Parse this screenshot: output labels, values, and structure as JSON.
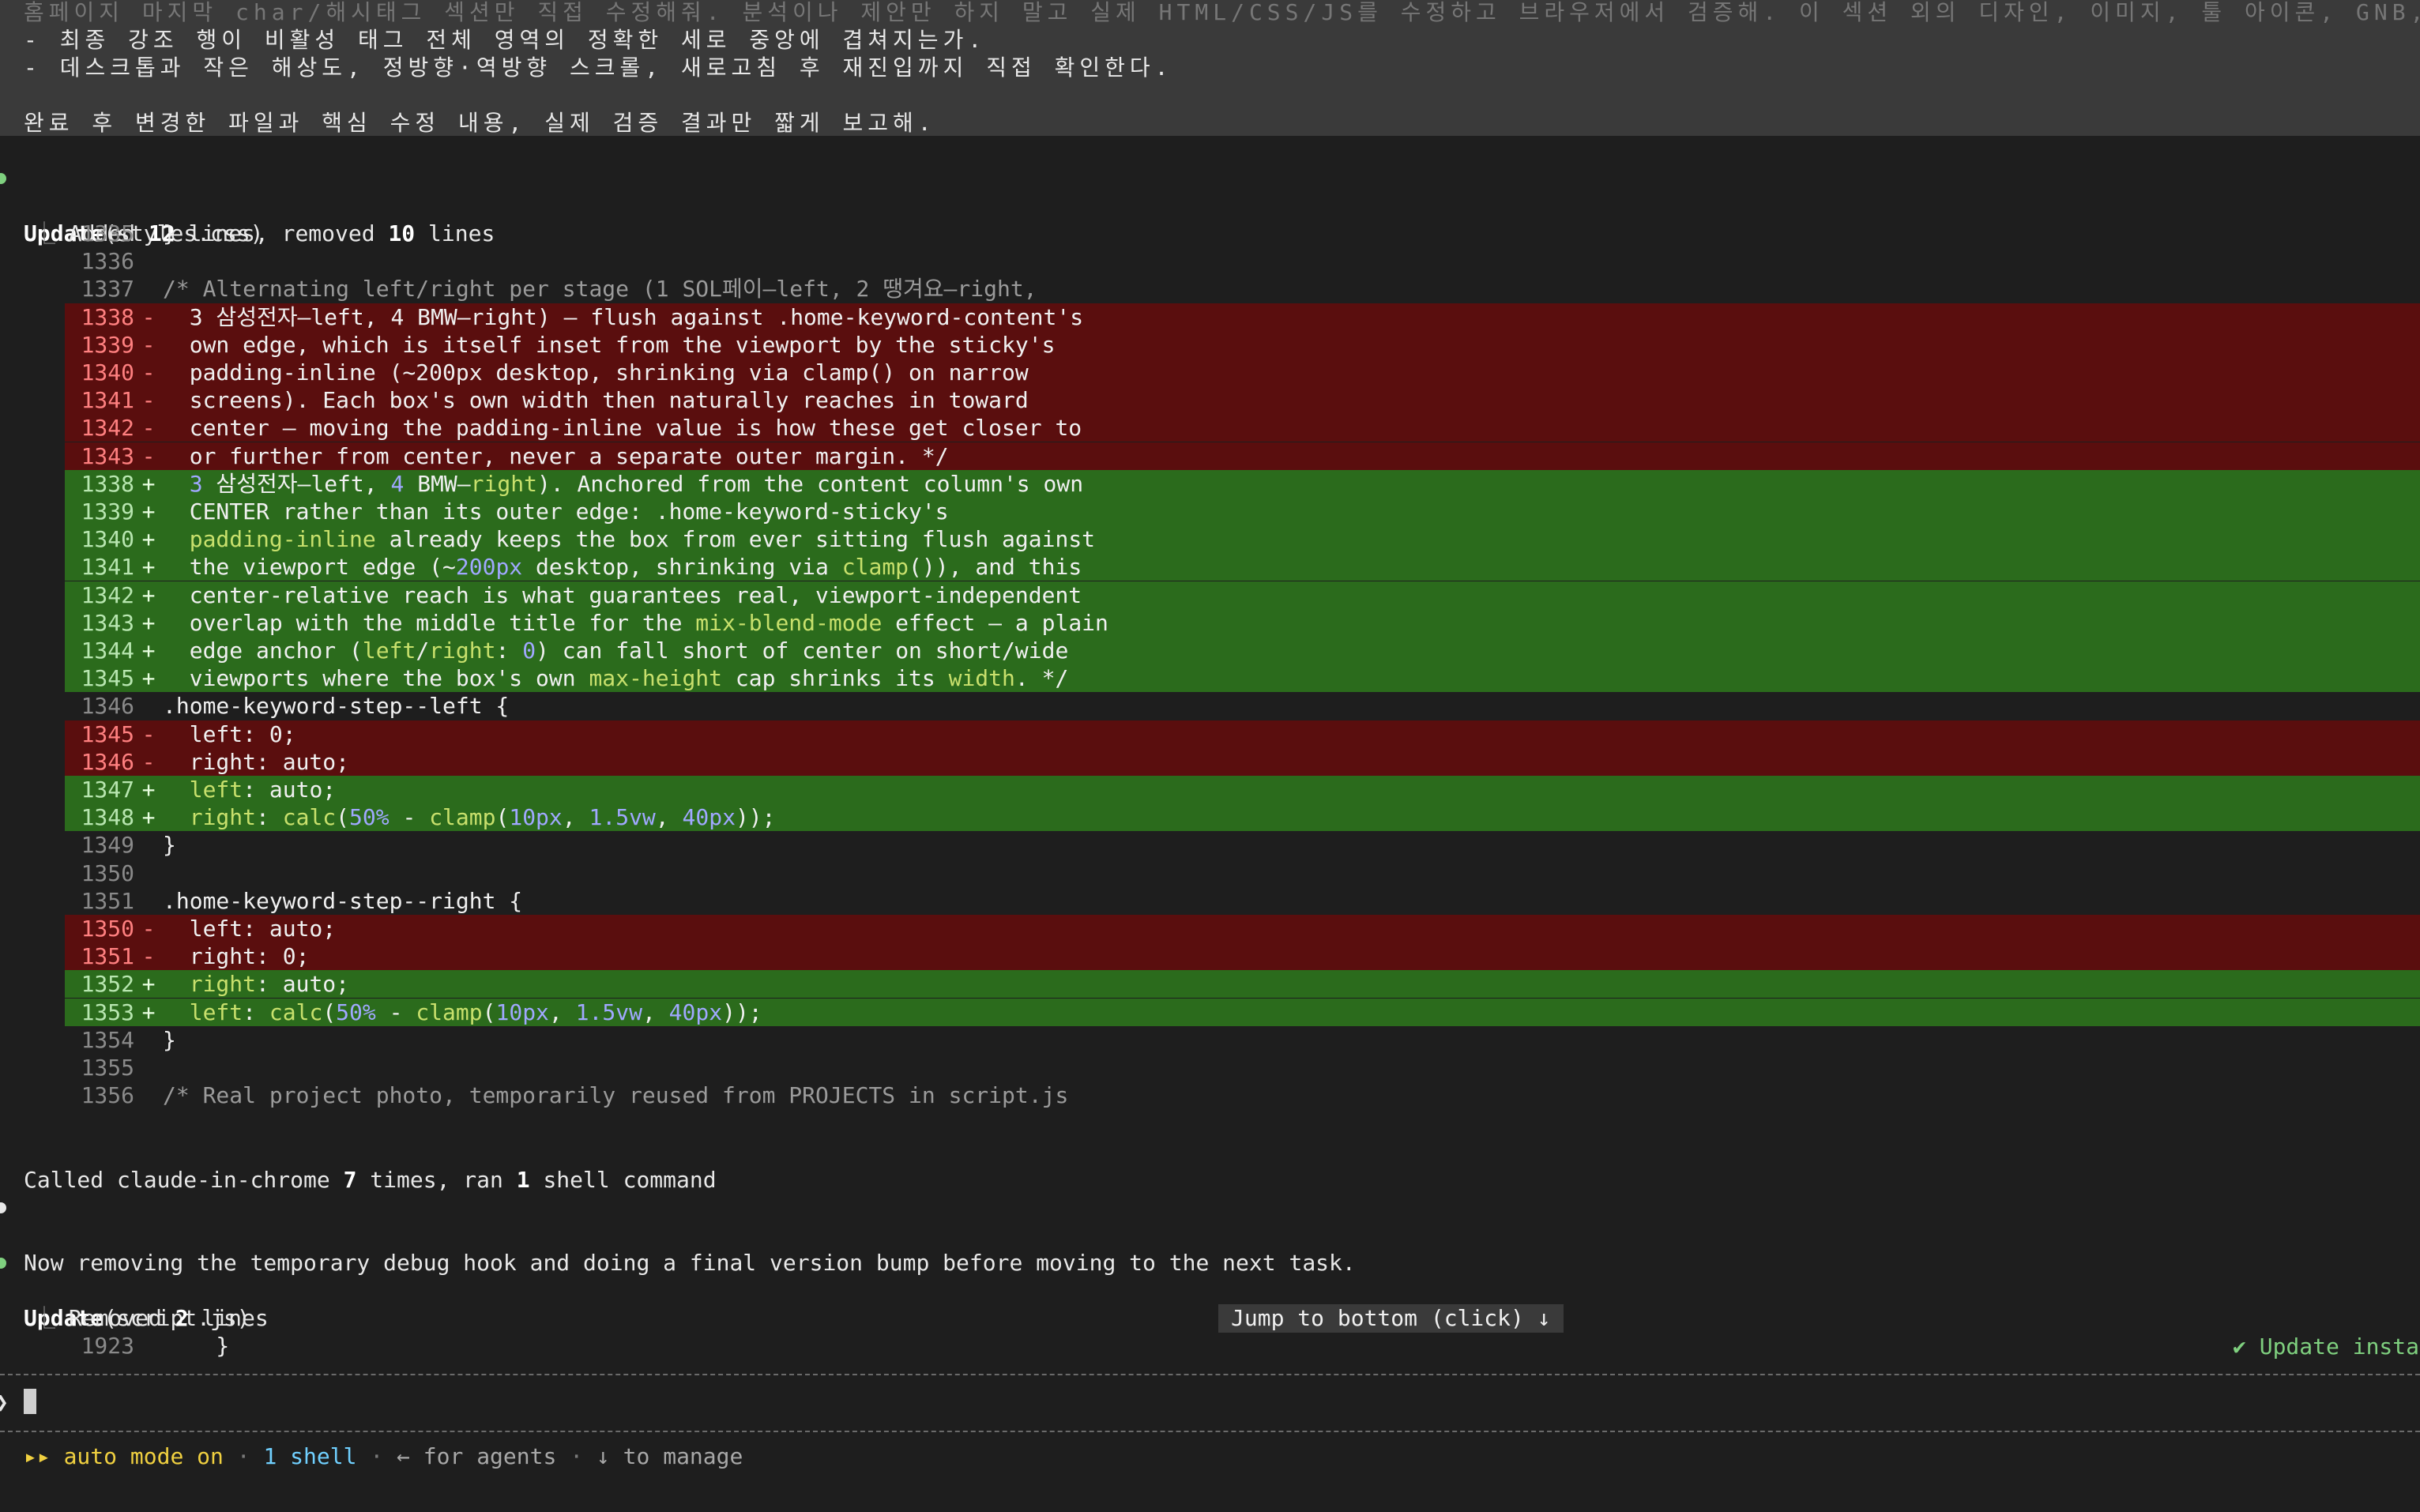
{
  "prompt": {
    "line0": "홈페이지 마지막 char/해시태그 섹션만 직접 수정해줘. 분석이나 제안만 하지 말고 실제 HTML/CSS/JS를 수정하고 브라우저에서 검증해. 이 섹션 외의 디자인, 이미지, 툴 아이콘, GNB,",
    "line1": "- 최종 강조 행이 비활성 태그 전체 영역의 정확한 세로 중앙에 겹쳐지는가.",
    "line2": "- 데스크톱과 작은 해상도, 정방향·역방향 스크롤, 새로고침 후 재진입까지 직접 확인한다.",
    "line3": "완료 후 변경한 파일과 핵심 수정 내용, 실제 검증 결과만 짧게 보고해."
  },
  "update1": {
    "verb": "Update",
    "file": "(styles.css)",
    "summary_pre": "Added ",
    "added": "12",
    "summary_mid": " lines, removed ",
    "removed": "10",
    "summary_post": " lines"
  },
  "diff": [
    {
      "n": "1335",
      "s": " ",
      "t": "ctx",
      "c": "}"
    },
    {
      "n": "1336",
      "s": " ",
      "t": "ctx",
      "c": ""
    },
    {
      "n": "1337",
      "s": " ",
      "t": "ctx",
      "c": "/* Alternating left/right per stage (1 SOL페이—left, 2 땡겨요—right,"
    },
    {
      "n": "1338",
      "s": "-",
      "t": "del",
      "c": "  3 삼성전자—left, 4 BMW—right) — flush against .home-keyword-content's"
    },
    {
      "n": "1339",
      "s": "-",
      "t": "del",
      "c": "  own edge, which is itself inset from the viewport by the sticky's"
    },
    {
      "n": "1340",
      "s": "-",
      "t": "del",
      "c": "  padding-inline (~200px desktop, shrinking via clamp() on narrow"
    },
    {
      "n": "1341",
      "s": "-",
      "t": "del",
      "c": "  screens). Each box's own width then naturally reaches in toward"
    },
    {
      "n": "1342",
      "s": "-",
      "t": "del",
      "c": "  center — moving the padding-inline value is how these get closer to"
    },
    {
      "n": "1343",
      "s": "-",
      "t": "del",
      "c": "  or further from center, never a separate outer margin. */"
    },
    {
      "n": "1338",
      "s": "+",
      "t": "add",
      "c": "  3 삼성전자—left, 4 BMW—right). Anchored from the content column's own"
    },
    {
      "n": "1339",
      "s": "+",
      "t": "add",
      "c": "  CENTER rather than its outer edge: .home-keyword-sticky's"
    },
    {
      "n": "1340",
      "s": "+",
      "t": "add",
      "c": "  padding-inline already keeps the box from ever sitting flush against"
    },
    {
      "n": "1341",
      "s": "+",
      "t": "add",
      "c": "  the viewport edge (~200px desktop, shrinking via clamp()), and this"
    },
    {
      "n": "1342",
      "s": "+",
      "t": "add",
      "c": "  center-relative reach is what guarantees real, viewport-independent"
    },
    {
      "n": "1343",
      "s": "+",
      "t": "add",
      "c": "  overlap with the middle title for the mix-blend-mode effect — a plain"
    },
    {
      "n": "1344",
      "s": "+",
      "t": "add",
      "c": "  edge anchor (left/right: 0) can fall short of center on short/wide"
    },
    {
      "n": "1345",
      "s": "+",
      "t": "add",
      "c": "  viewports where the box's own max-height cap shrinks its width. */"
    },
    {
      "n": "1346",
      "s": " ",
      "t": "ctx",
      "c": ".home-keyword-step--left {"
    },
    {
      "n": "1345",
      "s": "-",
      "t": "del",
      "c": "  left: 0;"
    },
    {
      "n": "1346",
      "s": "-",
      "t": "del",
      "c": "  right: auto;"
    },
    {
      "n": "1347",
      "s": "+",
      "t": "add",
      "c": "  left: auto;"
    },
    {
      "n": "1348",
      "s": "+",
      "t": "add",
      "c": "  right: calc(50% - clamp(10px, 1.5vw, 40px));"
    },
    {
      "n": "1349",
      "s": " ",
      "t": "ctx",
      "c": "}"
    },
    {
      "n": "1350",
      "s": " ",
      "t": "ctx",
      "c": ""
    },
    {
      "n": "1351",
      "s": " ",
      "t": "ctx",
      "c": ".home-keyword-step--right {"
    },
    {
      "n": "1350",
      "s": "-",
      "t": "del",
      "c": "  left: auto;"
    },
    {
      "n": "1351",
      "s": "-",
      "t": "del",
      "c": "  right: 0;"
    },
    {
      "n": "1352",
      "s": "+",
      "t": "add",
      "c": "  right: auto;"
    },
    {
      "n": "1353",
      "s": "+",
      "t": "add",
      "c": "  left: calc(50% - clamp(10px, 1.5vw, 40px));"
    },
    {
      "n": "1354",
      "s": " ",
      "t": "ctx",
      "c": "}"
    },
    {
      "n": "1355",
      "s": " ",
      "t": "ctx",
      "c": ""
    },
    {
      "n": "1356",
      "s": " ",
      "t": "ctx",
      "c": "/* Real project photo, temporarily reused from PROJECTS in script.js"
    }
  ],
  "called": {
    "pre": "Called claude-in-chrome ",
    "count": "7",
    "mid": " times, ran ",
    "shells": "1",
    "post": " shell command"
  },
  "message": "Now removing the temporary debug hook and doing a final version bump before moving to the next task.",
  "update2": {
    "verb": "Update",
    "file": "(script.js)",
    "summary_pre": "Removed ",
    "removed": "2",
    "summary_post": " lines",
    "line_num": "1923",
    "line_code": "    }"
  },
  "jump_label": "Jump to bottom (click) ↓",
  "update_status": "✔ Update insta",
  "footer": {
    "mode_icon": "▸▸",
    "mode": "auto mode on",
    "dot": " · ",
    "shells": "1 shell",
    "agents": "← for agents",
    "manage": "↓ to manage"
  },
  "colors": {
    "background": "#1e1e1e",
    "deleted_row": "#5a0e0e",
    "added_row": "#2b6b1c",
    "bullet_green": "#7fd07f",
    "mode_yellow": "#f0d040",
    "shell_cyan": "#70d0ff"
  }
}
